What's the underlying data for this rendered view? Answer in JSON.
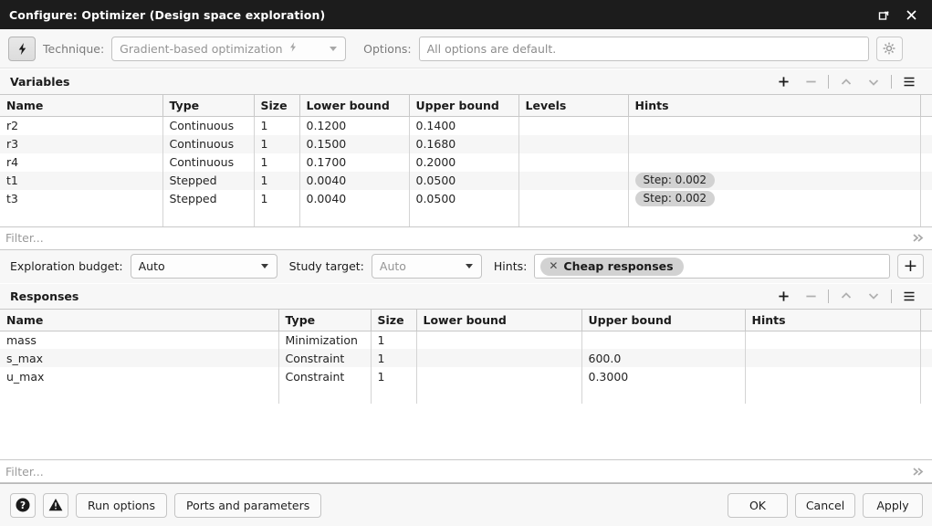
{
  "window": {
    "title": "Configure: Optimizer (Design space exploration)",
    "restore_icon": "restore-window-icon",
    "close_icon": "close-icon"
  },
  "technique_bar": {
    "mode_icon": "lightning-bolt-icon",
    "technique_label": "Technique:",
    "technique_value": "Gradient-based optimization",
    "technique_value_icon": "lightning-bolt-icon",
    "options_label": "Options:",
    "options_value": "All options are default.",
    "settings_icon": "gear-icon"
  },
  "variables": {
    "title": "Variables",
    "tools": {
      "add": "+",
      "remove": "−",
      "move_up": "chevron-up-icon",
      "move_down": "chevron-down-icon",
      "menu": "hamburger-menu-icon"
    },
    "columns": [
      "Name",
      "Type",
      "Size",
      "Lower bound",
      "Upper bound",
      "Levels",
      "Hints"
    ],
    "rows": [
      {
        "name": "r2",
        "type": "Continuous",
        "size": "1",
        "lower": "0.1200",
        "upper": "0.1400",
        "levels": "",
        "hint": ""
      },
      {
        "name": "r3",
        "type": "Continuous",
        "size": "1",
        "lower": "0.1500",
        "upper": "0.1680",
        "levels": "",
        "hint": ""
      },
      {
        "name": "r4",
        "type": "Continuous",
        "size": "1",
        "lower": "0.1700",
        "upper": "0.2000",
        "levels": "",
        "hint": ""
      },
      {
        "name": "t1",
        "type": "Stepped",
        "size": "1",
        "lower": "0.0040",
        "upper": "0.0500",
        "levels": "",
        "hint": "Step: 0.002"
      },
      {
        "name": "t3",
        "type": "Stepped",
        "size": "1",
        "lower": "0.0040",
        "upper": "0.0500",
        "levels": "",
        "hint": "Step: 0.002"
      }
    ],
    "filter_placeholder": "Filter...",
    "filter_expand_icon": "double-chevron-right-icon"
  },
  "options_strip": {
    "exploration_budget_label": "Exploration budget:",
    "exploration_budget_value": "Auto",
    "study_target_label": "Study target:",
    "study_target_value": "Auto",
    "hints_label": "Hints:",
    "hints_tokens": [
      {
        "label": "Cheap responses",
        "remove_icon": "close-small-icon"
      }
    ],
    "add_hint_button": "+"
  },
  "responses": {
    "title": "Responses",
    "tools": {
      "add": "+",
      "remove": "−",
      "move_up": "chevron-up-icon",
      "move_down": "chevron-down-icon",
      "menu": "hamburger-menu-icon"
    },
    "columns": [
      "Name",
      "Type",
      "Size",
      "Lower bound",
      "Upper bound",
      "Hints"
    ],
    "rows": [
      {
        "name": "mass",
        "type": "Minimization",
        "size": "1",
        "lower": "",
        "upper": "",
        "hint": ""
      },
      {
        "name": "s_max",
        "type": "Constraint",
        "size": "1",
        "lower": "",
        "upper": "600.0",
        "hint": ""
      },
      {
        "name": "u_max",
        "type": "Constraint",
        "size": "1",
        "lower": "",
        "upper": "0.3000",
        "hint": ""
      }
    ],
    "filter_placeholder": "Filter...",
    "filter_expand_icon": "double-chevron-right-icon"
  },
  "bottom_bar": {
    "help_icon": "help-circle-icon",
    "warning_icon": "warning-triangle-icon",
    "run_options": "Run options",
    "ports_and_parameters": "Ports and parameters",
    "ok": "OK",
    "cancel": "Cancel",
    "apply": "Apply"
  },
  "colors": {
    "titlebar_bg": "#1c1c1c",
    "panel_bg": "#f7f7f7",
    "row_alt_bg": "#f6f6f6",
    "pill_bg": "#d2d2d2",
    "grid_line": "#c8c8c8"
  }
}
